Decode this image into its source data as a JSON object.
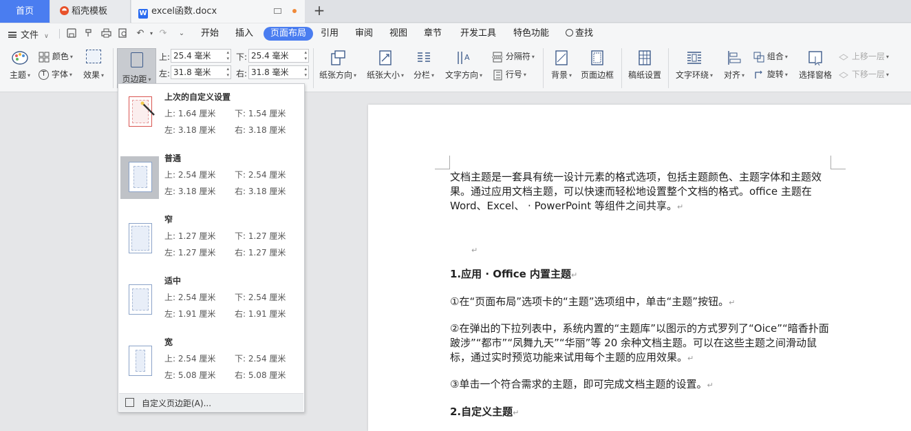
{
  "tabs": {
    "home": "首页",
    "daoke": "稻壳模板",
    "doc": "excel函数.docx"
  },
  "menu": {
    "file": "文件",
    "tabs": [
      "开始",
      "插入",
      "页面布局",
      "引用",
      "审阅",
      "视图",
      "章节",
      "开发工具",
      "特色功能"
    ],
    "active_tab": "页面布局",
    "search": "查找"
  },
  "ribbon": {
    "theme": "主题",
    "color": "颜色",
    "font": "字体",
    "effect": "效果",
    "margins": "页边距",
    "top_label": "上:",
    "top_value": "25.4 毫米",
    "bottom_label": "下:",
    "bottom_value": "25.4 毫米",
    "left_label": "左:",
    "left_value": "31.8 毫米",
    "right_label": "右:",
    "right_value": "31.8 毫米",
    "orientation": "纸张方向",
    "size": "纸张大小",
    "columns": "分栏",
    "text_direction": "文字方向",
    "breaks": "分隔符",
    "line_numbers": "行号",
    "background": "背景",
    "page_border": "页面边框",
    "grid_paper": "稿纸设置",
    "wrap_text": "文字环绕",
    "align": "对齐",
    "group": "组合",
    "rotate": "旋转",
    "selection_pane": "选择窗格",
    "bring_forward": "上移一层",
    "send_backward": "下移一层"
  },
  "dropdown": {
    "options": [
      {
        "title": "上次的自定义设置",
        "top": "上: 1.64 厘米",
        "bottom": "下: 1.54 厘米",
        "left": "左: 3.18 厘米",
        "right": "右: 3.18 厘米"
      },
      {
        "title": "普通",
        "top": "上: 2.54 厘米",
        "bottom": "下: 2.54 厘米",
        "left": "左: 3.18 厘米",
        "right": "右: 3.18 厘米"
      },
      {
        "title": "窄",
        "top": "上: 1.27 厘米",
        "bottom": "下: 1.27 厘米",
        "left": "左: 1.27 厘米",
        "right": "右: 1.27 厘米"
      },
      {
        "title": "适中",
        "top": "上: 2.54 厘米",
        "bottom": "下: 2.54 厘米",
        "left": "左: 1.91 厘米",
        "right": "右: 1.91 厘米"
      },
      {
        "title": "宽",
        "top": "上: 2.54 厘米",
        "bottom": "下: 2.54 厘米",
        "left": "左: 5.08 厘米",
        "right": "右: 5.08 厘米"
      }
    ],
    "custom": "自定义页边距(A)..."
  },
  "document": {
    "p1": "文档主题是一套具有统一设计元素的格式选项，包括主题颜色、主题字体和主题效果。通过应用文档主题，可以快速而轻松地设置整个文档的格式。office 主题在 Word、Excel、 · PowerPoint 等组件之间共享。",
    "h1": "1.应用 · Office 内置主题",
    "p2": "①在“页面布局”选项卡的“主题”选项组中，单击“主题”按钮。",
    "p3": "②在弹出的下拉列表中，系统内置的“主题库”以图示的方式罗列了“Oice”“暗香扑面跛涉”“都市”“凤舞九天”“华丽”等 20 余种文档主题。可以在这些主题之间滑动鼠标，通过实时预览功能来试用每个主题的应用效果。",
    "p4": "③单击一个符合需求的主题，即可完成文档主题的设置。",
    "h2": "2.自定义主题",
    "mark": "↵"
  }
}
